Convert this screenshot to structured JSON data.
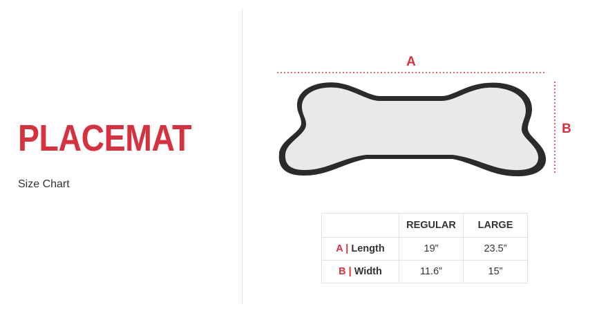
{
  "product": {
    "title": "PLACEMAT",
    "subtitle": "Size Chart"
  },
  "diagram": {
    "shape_icon": "bone-shape-icon",
    "dimension_a_label": "A",
    "dimension_b_label": "B",
    "accent_color": "#d7313f",
    "shape_fill_color": "#e9e9e9",
    "shape_border_color": "#2b2b2b"
  },
  "table": {
    "columns": [
      "",
      "REGULAR",
      "LARGE"
    ],
    "rows": [
      {
        "letter": "A",
        "separator": "|",
        "label": "Length",
        "regular": "19”",
        "large": "23.5”"
      },
      {
        "letter": "B",
        "separator": "|",
        "label": "Width",
        "regular": "11.6”",
        "large": "15”"
      }
    ]
  }
}
